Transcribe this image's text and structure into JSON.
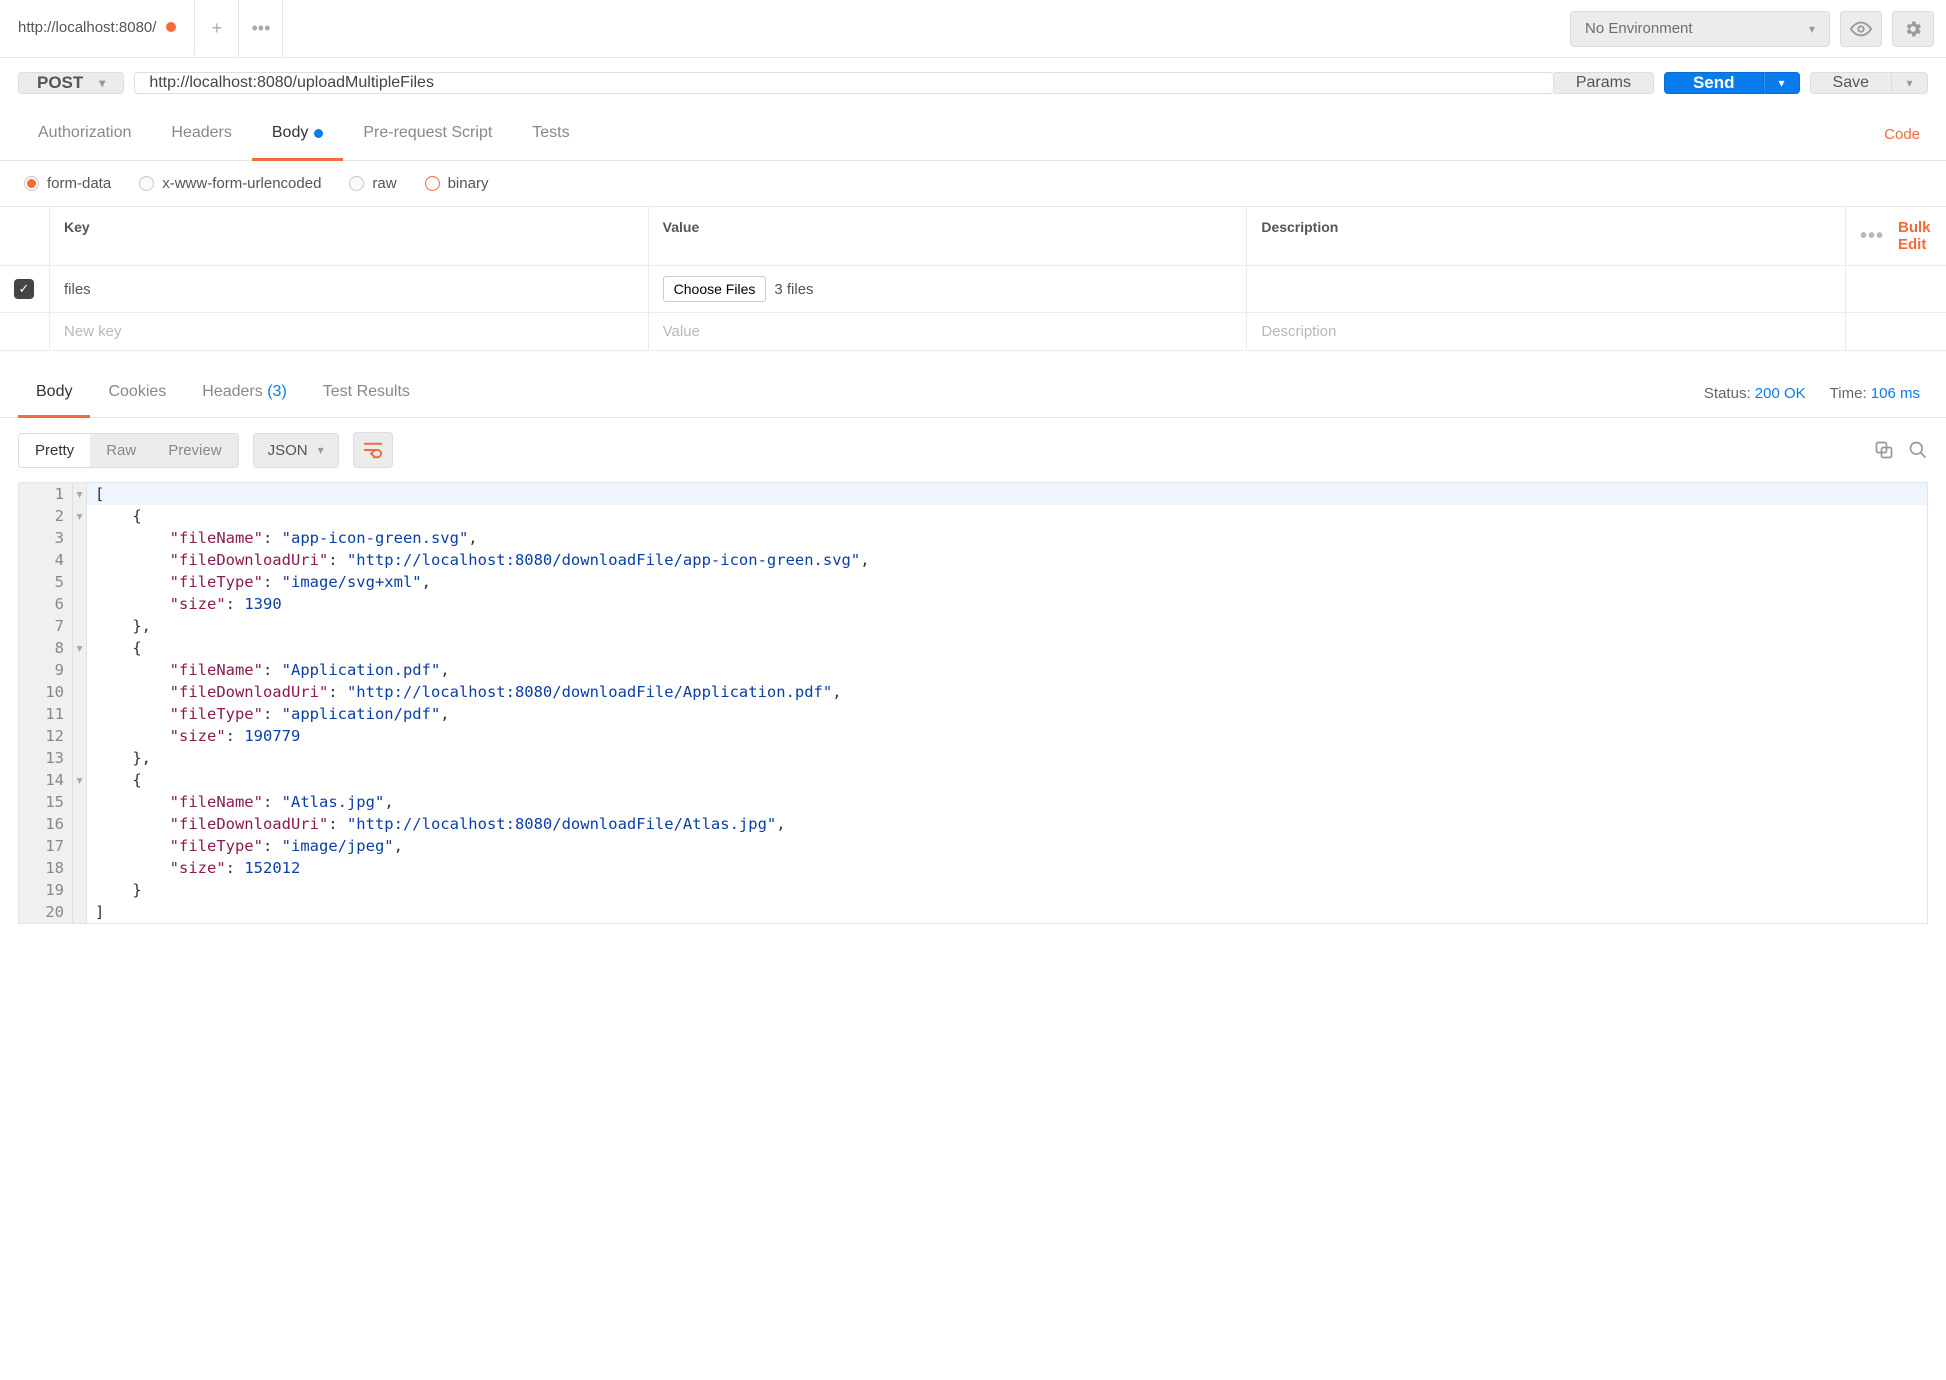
{
  "topbar": {
    "tab_title": "http://localhost:8080/",
    "env_label": "No Environment"
  },
  "request": {
    "method": "POST",
    "url": "http://localhost:8080/uploadMultipleFiles",
    "params_btn": "Params",
    "send_btn": "Send",
    "save_btn": "Save"
  },
  "req_tabs": {
    "authorization": "Authorization",
    "headers": "Headers",
    "body": "Body",
    "prerequest": "Pre-request Script",
    "tests": "Tests",
    "code": "Code"
  },
  "body_types": {
    "formdata": "form-data",
    "urlencoded": "x-www-form-urlencoded",
    "raw": "raw",
    "binary": "binary"
  },
  "formdata": {
    "header_key": "Key",
    "header_value": "Value",
    "header_desc": "Description",
    "bulkedit": "Bulk Edit",
    "row_key": "files",
    "choose_files": "Choose Files",
    "file_count": "3 files",
    "ph_key": "New key",
    "ph_value": "Value",
    "ph_desc": "Description"
  },
  "resp_tabs": {
    "body": "Body",
    "cookies": "Cookies",
    "headers": "Headers",
    "headers_count": "(3)",
    "tests": "Test Results",
    "status_label": "Status:",
    "status_value": "200 OK",
    "time_label": "Time:",
    "time_value": "106 ms"
  },
  "viewer": {
    "pretty": "Pretty",
    "raw": "Raw",
    "preview": "Preview",
    "format": "JSON"
  },
  "json_lines": [
    {
      "n": "1",
      "foldable": true,
      "indent": 0,
      "tokens": [
        [
          "punc",
          "["
        ]
      ]
    },
    {
      "n": "2",
      "foldable": true,
      "indent": 4,
      "tokens": [
        [
          "punc",
          "{"
        ]
      ]
    },
    {
      "n": "3",
      "foldable": false,
      "indent": 8,
      "tokens": [
        [
          "key",
          "\"fileName\""
        ],
        [
          "punc",
          ": "
        ],
        [
          "str",
          "\"app-icon-green.svg\""
        ],
        [
          "punc",
          ","
        ]
      ]
    },
    {
      "n": "4",
      "foldable": false,
      "indent": 8,
      "tokens": [
        [
          "key",
          "\"fileDownloadUri\""
        ],
        [
          "punc",
          ": "
        ],
        [
          "str",
          "\"http://localhost:8080/downloadFile/app-icon-green.svg\""
        ],
        [
          "punc",
          ","
        ]
      ]
    },
    {
      "n": "5",
      "foldable": false,
      "indent": 8,
      "tokens": [
        [
          "key",
          "\"fileType\""
        ],
        [
          "punc",
          ": "
        ],
        [
          "str",
          "\"image/svg+xml\""
        ],
        [
          "punc",
          ","
        ]
      ]
    },
    {
      "n": "6",
      "foldable": false,
      "indent": 8,
      "tokens": [
        [
          "key",
          "\"size\""
        ],
        [
          "punc",
          ": "
        ],
        [
          "num",
          "1390"
        ]
      ]
    },
    {
      "n": "7",
      "foldable": false,
      "indent": 4,
      "tokens": [
        [
          "punc",
          "},"
        ]
      ]
    },
    {
      "n": "8",
      "foldable": true,
      "indent": 4,
      "tokens": [
        [
          "punc",
          "{"
        ]
      ]
    },
    {
      "n": "9",
      "foldable": false,
      "indent": 8,
      "tokens": [
        [
          "key",
          "\"fileName\""
        ],
        [
          "punc",
          ": "
        ],
        [
          "str",
          "\"Application.pdf\""
        ],
        [
          "punc",
          ","
        ]
      ]
    },
    {
      "n": "10",
      "foldable": false,
      "indent": 8,
      "tokens": [
        [
          "key",
          "\"fileDownloadUri\""
        ],
        [
          "punc",
          ": "
        ],
        [
          "str",
          "\"http://localhost:8080/downloadFile/Application.pdf\""
        ],
        [
          "punc",
          ","
        ]
      ]
    },
    {
      "n": "11",
      "foldable": false,
      "indent": 8,
      "tokens": [
        [
          "key",
          "\"fileType\""
        ],
        [
          "punc",
          ": "
        ],
        [
          "str",
          "\"application/pdf\""
        ],
        [
          "punc",
          ","
        ]
      ]
    },
    {
      "n": "12",
      "foldable": false,
      "indent": 8,
      "tokens": [
        [
          "key",
          "\"size\""
        ],
        [
          "punc",
          ": "
        ],
        [
          "num",
          "190779"
        ]
      ]
    },
    {
      "n": "13",
      "foldable": false,
      "indent": 4,
      "tokens": [
        [
          "punc",
          "},"
        ]
      ]
    },
    {
      "n": "14",
      "foldable": true,
      "indent": 4,
      "tokens": [
        [
          "punc",
          "{"
        ]
      ]
    },
    {
      "n": "15",
      "foldable": false,
      "indent": 8,
      "tokens": [
        [
          "key",
          "\"fileName\""
        ],
        [
          "punc",
          ": "
        ],
        [
          "str",
          "\"Atlas.jpg\""
        ],
        [
          "punc",
          ","
        ]
      ]
    },
    {
      "n": "16",
      "foldable": false,
      "indent": 8,
      "tokens": [
        [
          "key",
          "\"fileDownloadUri\""
        ],
        [
          "punc",
          ": "
        ],
        [
          "str",
          "\"http://localhost:8080/downloadFile/Atlas.jpg\""
        ],
        [
          "punc",
          ","
        ]
      ]
    },
    {
      "n": "17",
      "foldable": false,
      "indent": 8,
      "tokens": [
        [
          "key",
          "\"fileType\""
        ],
        [
          "punc",
          ": "
        ],
        [
          "str",
          "\"image/jpeg\""
        ],
        [
          "punc",
          ","
        ]
      ]
    },
    {
      "n": "18",
      "foldable": false,
      "indent": 8,
      "tokens": [
        [
          "key",
          "\"size\""
        ],
        [
          "punc",
          ": "
        ],
        [
          "num",
          "152012"
        ]
      ]
    },
    {
      "n": "19",
      "foldable": false,
      "indent": 4,
      "tokens": [
        [
          "punc",
          "}"
        ]
      ]
    },
    {
      "n": "20",
      "foldable": false,
      "indent": 0,
      "tokens": [
        [
          "punc",
          "]"
        ]
      ]
    }
  ]
}
